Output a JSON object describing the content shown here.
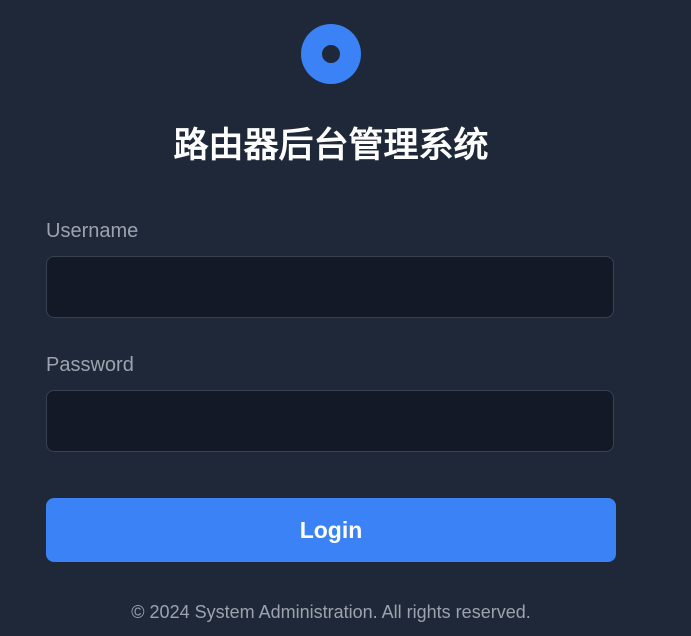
{
  "logo": {
    "icon": "circle-logo-icon",
    "color": "#3b82f6"
  },
  "title": "路由器后台管理系统",
  "form": {
    "username_label": "Username",
    "username_value": "",
    "password_label": "Password",
    "password_value": "",
    "login_label": "Login"
  },
  "footer": "© 2024 System Administration. All rights reserved.",
  "colors": {
    "background": "#1f2838",
    "input_background": "#131926",
    "accent": "#3b82f6"
  }
}
